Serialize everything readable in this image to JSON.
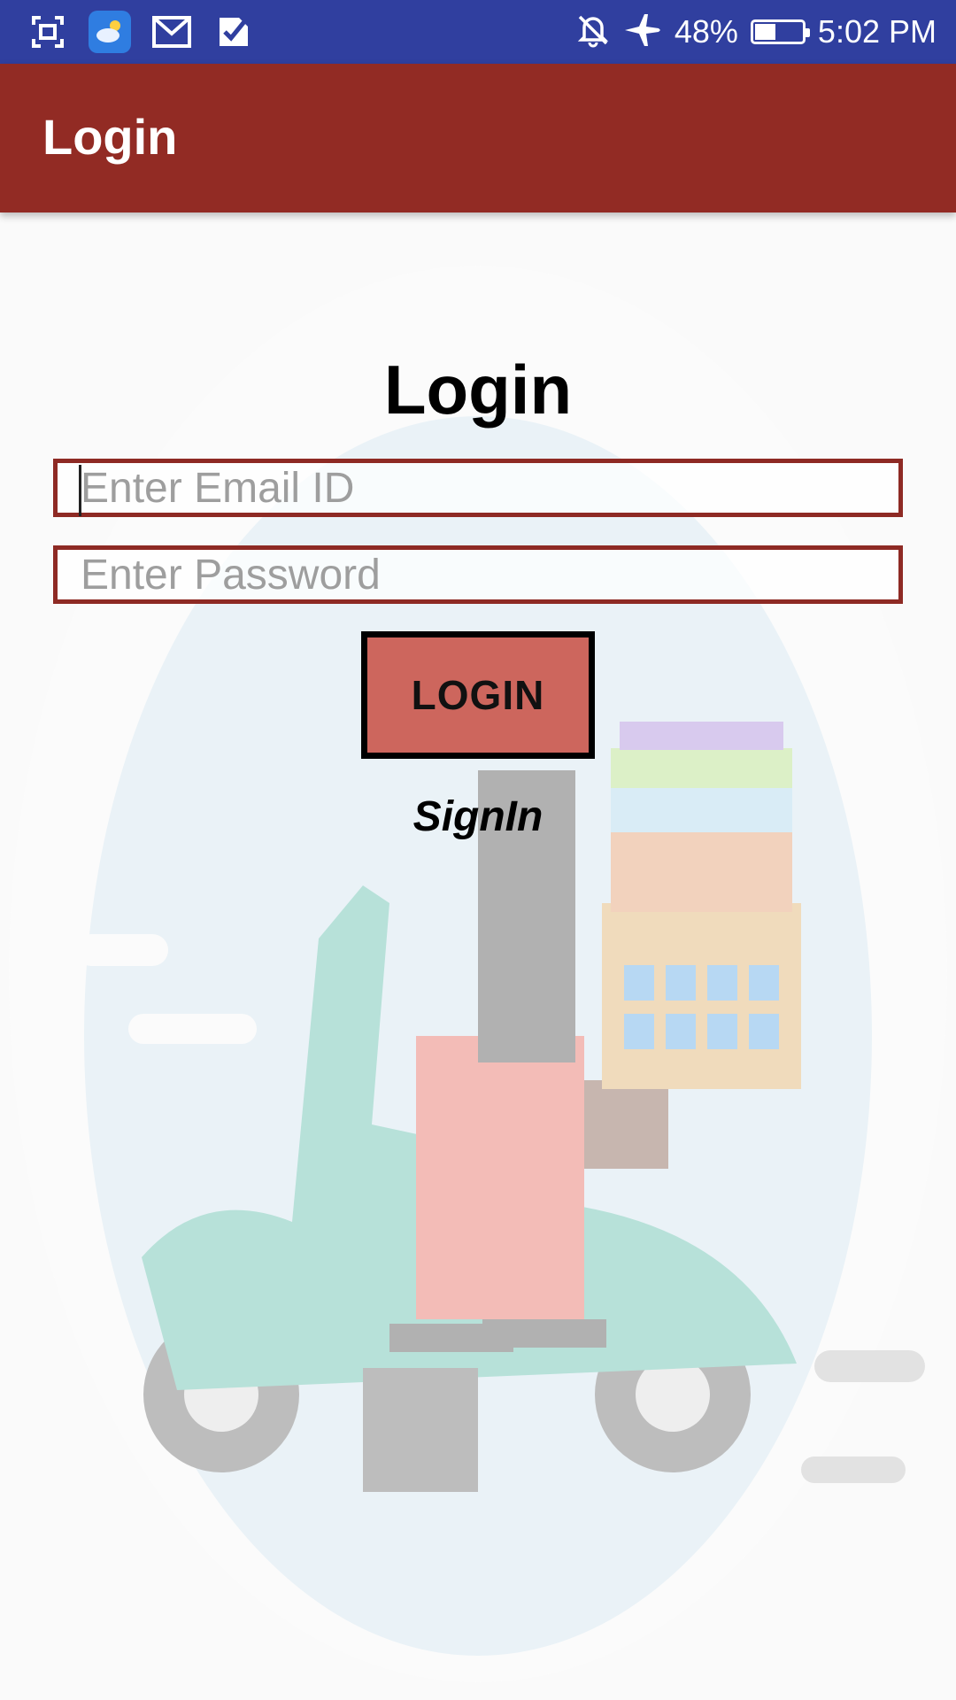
{
  "status_bar": {
    "left_icons": [
      "screenshot-icon",
      "weather-icon",
      "gmail-icon",
      "tasks-icon"
    ],
    "right_icons": [
      "notifications-off-icon",
      "airplane-mode-icon",
      "battery-icon"
    ],
    "battery_percent": "48%",
    "battery_level": 0.48,
    "time": "5:02 PM"
  },
  "app_bar": {
    "title": "Login"
  },
  "form": {
    "title": "Login",
    "email_placeholder": "Enter Email ID",
    "email_value": "",
    "password_placeholder": "Enter Password",
    "password_value": "",
    "login_button": "LOGIN",
    "signin_link": "SignIn"
  },
  "colors": {
    "status_bar": "#303f9f",
    "app_bar": "#922b24",
    "input_border": "#8e2a24",
    "button_fill": "#cd665d",
    "button_border": "#000000"
  }
}
